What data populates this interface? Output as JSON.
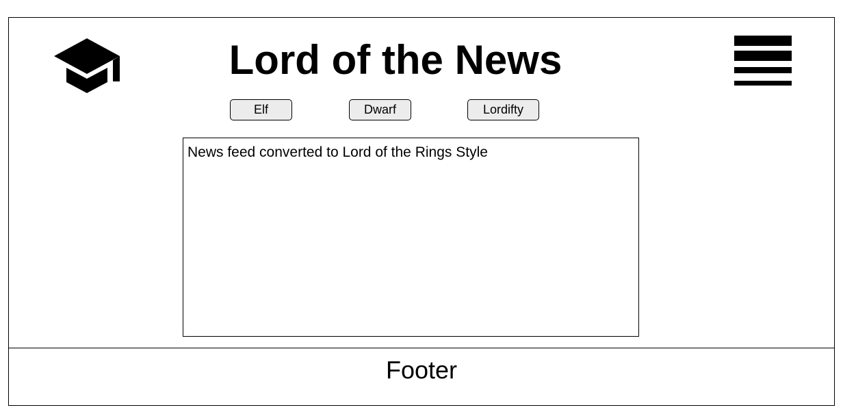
{
  "header": {
    "title": "Lord of the News",
    "logo_icon": "graduation-cap-icon",
    "menu_icon": "hamburger-menu-icon"
  },
  "style_buttons": [
    {
      "label": "Elf"
    },
    {
      "label": "Dwarf"
    },
    {
      "label": "Lordifty"
    }
  ],
  "feed": {
    "text": "News feed converted to Lord of the Rings Style"
  },
  "footer": {
    "label": "Footer"
  }
}
